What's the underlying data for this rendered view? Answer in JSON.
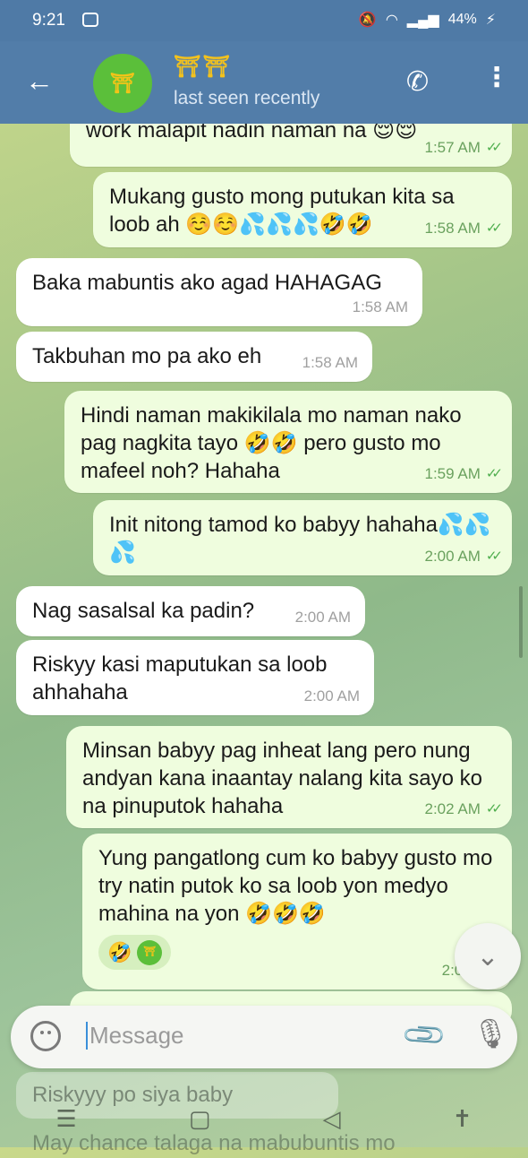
{
  "status": {
    "time": "9:21",
    "battery": "44%"
  },
  "header": {
    "back_icon": "arrow-left-icon",
    "name": "⛩⛩",
    "avatar_text": "⛩",
    "subtitle": "last seen recently"
  },
  "messages": [
    {
      "side": "out",
      "text": "work malapit nadin naman na 😌😌",
      "time": "1:57 AM"
    },
    {
      "side": "out",
      "text": "Mukang gusto mong putukan kita sa loob ah ☺️☺️💦💦💦🤣🤣",
      "time": "1:58 AM"
    },
    {
      "side": "in",
      "text": "Baka mabuntis ako agad HAHAGAG",
      "time": "1:58 AM"
    },
    {
      "side": "in",
      "text": "Takbuhan mo pa ako eh",
      "time": "1:58 AM"
    },
    {
      "side": "out",
      "text": "Hindi naman makikilala mo naman nako pag nagkita tayo 🤣🤣 pero gusto mo mafeel noh? Hahaha",
      "time": "1:59 AM"
    },
    {
      "side": "out",
      "text": "Init nitong tamod ko babyy hahaha💦💦💦",
      "time": "2:00 AM"
    },
    {
      "side": "in",
      "text": "Nag sasalsal ka padin?",
      "time": "2:00 AM"
    },
    {
      "side": "in",
      "text": "Riskyy kasi maputukan sa loob ahhahaha",
      "time": "2:00 AM"
    },
    {
      "side": "out",
      "text": "Minsan babyy pag inheat lang pero nung andyan kana inaantay nalang kita sayo ko na pinuputok hahaha",
      "time": "2:02 AM"
    },
    {
      "side": "out",
      "text": "Yung pangatlong cum ko babyy gusto mo try natin putok ko sa loob yon medyo mahina na yon 🤣🤣🤣",
      "time": "2:02 AM",
      "reaction": "🤣"
    }
  ],
  "input": {
    "placeholder": "Message"
  },
  "ghost": {
    "line1": "Riskyyy po siya baby",
    "line2": "May chance talaga na mabubuntis mo"
  }
}
